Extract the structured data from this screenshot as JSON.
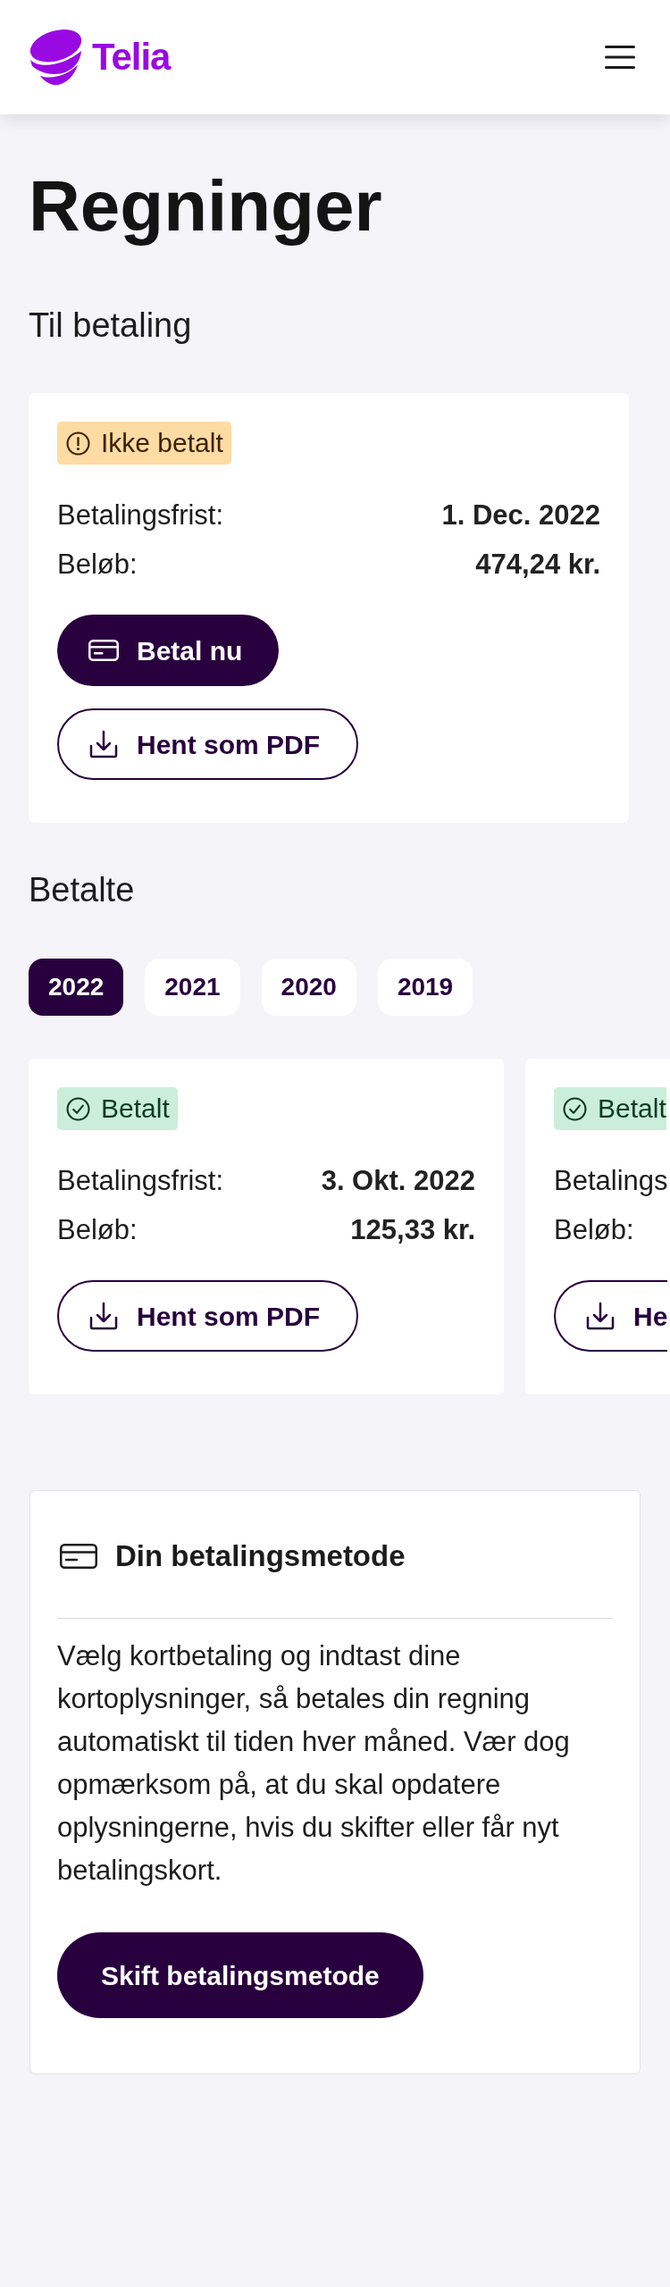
{
  "header": {
    "logo_text": "Telia"
  },
  "page_title": "Regninger",
  "to_pay": {
    "heading": "Til betaling",
    "bills": [
      {
        "status": {
          "kind": "unpaid",
          "label": "Ikke betalt"
        },
        "rows": [
          {
            "label": "Betalingsfrist:",
            "value": "1. Dec. 2022"
          },
          {
            "label": "Beløb:",
            "value": "474,24 kr."
          }
        ],
        "buttons": [
          {
            "kind": "pay",
            "label": "Betal nu"
          },
          {
            "kind": "download",
            "label": "Hent som PDF"
          }
        ]
      }
    ]
  },
  "paid": {
    "heading": "Betalte",
    "year_tabs": [
      {
        "label": "2022",
        "selected": true
      },
      {
        "label": "2021",
        "selected": false
      },
      {
        "label": "2020",
        "selected": false
      },
      {
        "label": "2019",
        "selected": false
      }
    ],
    "bills": [
      {
        "status": {
          "kind": "paid",
          "label": "Betalt"
        },
        "rows": [
          {
            "label": "Betalingsfrist:",
            "value": "3. Okt. 2022"
          },
          {
            "label": "Beløb:",
            "value": "125,33 kr."
          }
        ],
        "buttons": [
          {
            "kind": "download",
            "label": "Hent som PDF"
          }
        ]
      },
      {
        "status": {
          "kind": "paid",
          "label": "Betalt"
        },
        "rows": [
          {
            "label": "Betalings"
          },
          {
            "label": "Beløb:"
          }
        ],
        "buttons": [
          {
            "kind": "download",
            "label": "He"
          }
        ]
      }
    ]
  },
  "payment_method": {
    "title": "Din betalingsmetode",
    "description": "Vælg kortbetaling og indtast dine kortoplysninger, så betales din regning automatiskt til tiden hver måned. Vær dog opmærksom på, at du skal opdatere oplysningerne, hvis du skifter eller får nyt betalingskort.",
    "button": "Skift betalingsmetode"
  }
}
